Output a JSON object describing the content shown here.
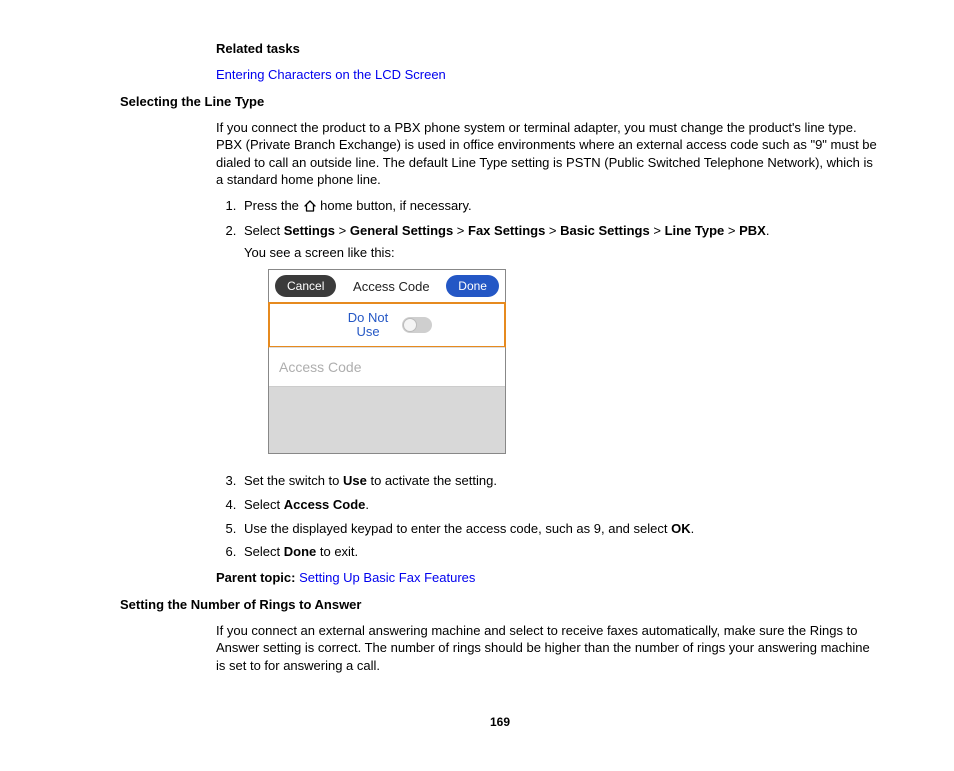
{
  "related_tasks_label": "Related tasks",
  "related_link": "Entering Characters on the LCD Screen",
  "section1_heading": "Selecting the Line Type",
  "section1_intro": "If you connect the product to a PBX phone system or terminal adapter, you must change the product's line type. PBX (Private Branch Exchange) is used in office environments where an external access code such as \"9\" must be dialed to call an outside line. The default Line Type setting is PSTN (Public Switched Telephone Network), which is a standard home phone line.",
  "step1_prefix": "Press the ",
  "step1_suffix": " home button, if necessary.",
  "step2_prefix": "Select ",
  "step2_path": [
    "Settings",
    "General Settings",
    "Fax Settings",
    "Basic Settings",
    "Line Type",
    "PBX"
  ],
  "step2_sep": " > ",
  "step2_after": "You see a screen like this:",
  "lcd": {
    "cancel": "Cancel",
    "title": "Access Code",
    "done": "Done",
    "do_not_use": "Do Not Use",
    "access_code_placeholder": "Access Code"
  },
  "step3_prefix": "Set the switch to ",
  "step3_bold": "Use",
  "step3_suffix": " to activate the setting.",
  "step4_prefix": "Select ",
  "step4_bold": "Access Code",
  "step4_suffix": ".",
  "step5_prefix": "Use the displayed keypad to enter the access code, such as 9, and select ",
  "step5_bold": "OK",
  "step5_suffix": ".",
  "step6_prefix": "Select ",
  "step6_bold": "Done",
  "step6_suffix": " to exit.",
  "parent_topic_label": "Parent topic: ",
  "parent_topic_link": "Setting Up Basic Fax Features",
  "section2_heading": "Setting the Number of Rings to Answer",
  "section2_intro": "If you connect an external answering machine and select to receive faxes automatically, make sure the Rings to Answer setting is correct. The number of rings should be higher than the number of rings your answering machine is set to for answering a call.",
  "page_number": "169"
}
